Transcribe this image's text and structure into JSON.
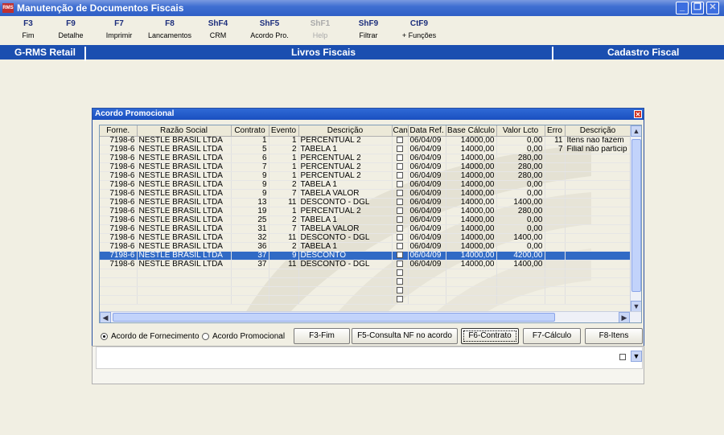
{
  "window": {
    "title": "Manutenção de Documentos Fiscais",
    "logo": "RMS"
  },
  "toolbar": [
    {
      "key": "F3",
      "label": "Fim",
      "enabled": true
    },
    {
      "key": "F9",
      "label": "Detalhe",
      "enabled": true
    },
    {
      "key": "F7",
      "label": "Imprimir",
      "enabled": true
    },
    {
      "key": "F8",
      "label": "Lancamentos",
      "enabled": true
    },
    {
      "key": "ShF4",
      "label": "CRM",
      "enabled": true
    },
    {
      "key": "ShF5",
      "label": "Acordo Pro.",
      "enabled": true
    },
    {
      "key": "ShF1",
      "label": "Help",
      "enabled": false
    },
    {
      "key": "ShF9",
      "label": "Filtrar",
      "enabled": true
    },
    {
      "key": "CtF9",
      "label": "+ Funções",
      "enabled": true
    }
  ],
  "header": {
    "left": "G-RMS Retail",
    "center": "Livros Fiscais",
    "right": "Cadastro Fiscal"
  },
  "dialog": {
    "title": "Acordo Promocional",
    "columns": [
      "Forne.",
      "Razão Social",
      "Contrato",
      "Evento",
      "Descrição",
      "Can",
      "Data Ref.",
      "Base Cálculo",
      "Valor Lcto",
      "Erro",
      "Descrição"
    ],
    "rows": [
      [
        "7198-6",
        "NESTLE BRASIL LTDA",
        "1",
        "1",
        "PERCENTUAL 2",
        "",
        "06/04/09",
        "14000,00",
        "0,00",
        "11",
        "Itens nao fazem"
      ],
      [
        "7198-6",
        "NESTLE BRASIL LTDA",
        "5",
        "2",
        "TABELA 1",
        "",
        "06/04/09",
        "14000,00",
        "0,00",
        "7",
        "Filial não particip"
      ],
      [
        "7198-6",
        "NESTLE BRASIL LTDA",
        "6",
        "1",
        "PERCENTUAL 2",
        "",
        "06/04/09",
        "14000,00",
        "280,00",
        "",
        ""
      ],
      [
        "7198-6",
        "NESTLE BRASIL LTDA",
        "7",
        "1",
        "PERCENTUAL 2",
        "",
        "06/04/09",
        "14000,00",
        "280,00",
        "",
        ""
      ],
      [
        "7198-6",
        "NESTLE BRASIL LTDA",
        "9",
        "1",
        "PERCENTUAL 2",
        "",
        "06/04/09",
        "14000,00",
        "280,00",
        "",
        ""
      ],
      [
        "7198-6",
        "NESTLE BRASIL LTDA",
        "9",
        "2",
        "TABELA 1",
        "",
        "06/04/09",
        "14000,00",
        "0,00",
        "",
        ""
      ],
      [
        "7198-6",
        "NESTLE BRASIL LTDA",
        "9",
        "7",
        "TABELA VALOR",
        "",
        "06/04/09",
        "14000,00",
        "0,00",
        "",
        ""
      ],
      [
        "7198-6",
        "NESTLE BRASIL LTDA",
        "13",
        "11",
        "DESCONTO - DGL",
        "",
        "06/04/09",
        "14000,00",
        "1400,00",
        "",
        ""
      ],
      [
        "7198-6",
        "NESTLE BRASIL LTDA",
        "19",
        "1",
        "PERCENTUAL 2",
        "",
        "06/04/09",
        "14000,00",
        "280,00",
        "",
        ""
      ],
      [
        "7198-6",
        "NESTLE BRASIL LTDA",
        "25",
        "2",
        "TABELA 1",
        "",
        "06/04/09",
        "14000,00",
        "0,00",
        "",
        ""
      ],
      [
        "7198-6",
        "NESTLE BRASIL LTDA",
        "31",
        "7",
        "TABELA VALOR",
        "",
        "06/04/09",
        "14000,00",
        "0,00",
        "",
        ""
      ],
      [
        "7198-6",
        "NESTLE BRASIL LTDA",
        "32",
        "11",
        "DESCONTO - DGL",
        "",
        "06/04/09",
        "14000,00",
        "1400,00",
        "",
        ""
      ],
      [
        "7198-6",
        "NESTLE BRASIL LTDA",
        "36",
        "2",
        "TABELA 1",
        "",
        "06/04/09",
        "14000,00",
        "0,00",
        "",
        ""
      ],
      [
        "7198-6",
        "NESTLE BRASIL LTDA",
        "37",
        "9",
        "DESCONTO",
        "",
        "06/04/09",
        "14000,00",
        "4200,00",
        "",
        ""
      ],
      [
        "7198-6",
        "NESTLE BRASIL LTDA",
        "37",
        "11",
        "DESCONTO - DGL",
        "",
        "06/04/09",
        "14000,00",
        "1400,00",
        "",
        ""
      ]
    ],
    "selected_row": 13,
    "empty_rows": 4,
    "radios": [
      {
        "label": "Acordo de Fornecimento",
        "checked": true
      },
      {
        "label": "Acordo Promocional",
        "checked": false
      }
    ],
    "buttons": {
      "fim": "F3-Fim",
      "consulta": "F5-Consulta NF no acordo",
      "contrato": "F6-Contrato",
      "calculo": "F7-Cálculo",
      "itens": "F8-Itens"
    }
  },
  "colors": {
    "title_bar": "#2f5fc6",
    "header_bar": "#1b4fb0",
    "selection": "#316ac5",
    "background": "#f1efe3"
  }
}
